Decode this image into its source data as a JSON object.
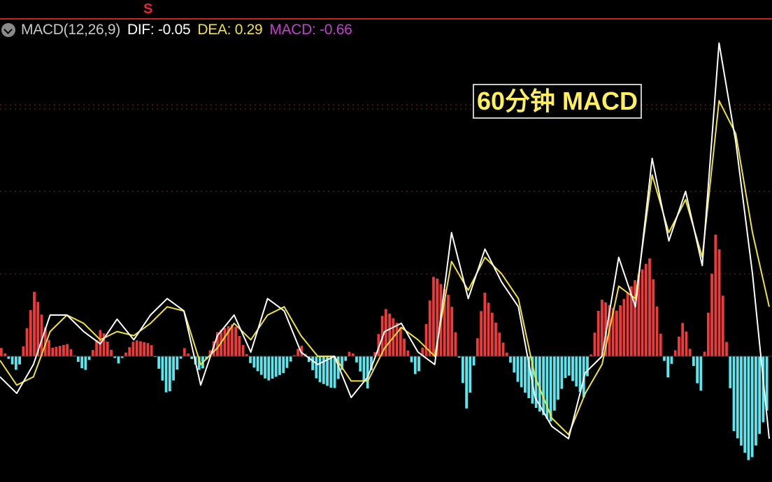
{
  "indicator": {
    "name": "MACD(12,26,9)",
    "dif_text": "DIF: -0.05",
    "dea_text": "DEA: 0.29",
    "macd_text": "MACD: -0.66"
  },
  "title_box": "60分钟 MACD",
  "top_marker": "S",
  "colors": {
    "background": "#000000",
    "dif": "#ffffff",
    "dea": "#f1e331",
    "macd_label": "#c43fd0",
    "positive_bar": "#f03a3a",
    "negative_bar": "#5ae8f0",
    "legend_name": "#c8c8c8",
    "grid": "#8a1e1e",
    "top_border": "#c42424"
  },
  "chart_data": {
    "type": "line",
    "title": "60分钟 MACD",
    "grid": true,
    "ylim": [
      -1.6,
      4.3
    ],
    "series": [
      {
        "name": "DIF",
        "values": [
          -0.25,
          -0.45,
          -0.1,
          0.5,
          0.5,
          0.3,
          0.15,
          0.45,
          0.2,
          0.5,
          0.7,
          0.55,
          -0.35,
          0.25,
          0.5,
          0.05,
          0.7,
          0.55,
          0.05,
          -0.1,
          0.0,
          -0.5,
          -0.25,
          0.3,
          0.4,
          0.05,
          -0.1,
          1.5,
          0.7,
          1.3,
          0.9,
          0.6,
          -0.5,
          -0.85,
          -1.0,
          -0.2,
          0.0,
          1.2,
          0.6,
          2.4,
          1.4,
          2.0,
          1.1,
          3.8,
          2.6,
          1.0,
          -1.0
        ]
      },
      {
        "name": "DEA",
        "values": [
          -0.05,
          -0.35,
          -0.25,
          0.3,
          0.5,
          0.4,
          0.2,
          0.3,
          0.25,
          0.4,
          0.6,
          0.55,
          -0.1,
          0.1,
          0.4,
          0.2,
          0.5,
          0.6,
          0.25,
          0.0,
          0.0,
          -0.3,
          -0.3,
          0.1,
          0.35,
          0.2,
          0.0,
          1.15,
          0.8,
          1.2,
          1.0,
          0.7,
          -0.25,
          -0.75,
          -0.95,
          -0.45,
          -0.1,
          0.85,
          0.7,
          2.2,
          1.5,
          1.9,
          1.2,
          3.1,
          2.7,
          1.5,
          0.6
        ]
      },
      {
        "name": "MACD",
        "values": [
          0.1,
          -0.2,
          0.8,
          0.1,
          0.15,
          -0.2,
          0.35,
          -0.1,
          0.2,
          0.15,
          -0.5,
          0.1,
          -0.2,
          0.3,
          0.4,
          -0.1,
          -0.3,
          -0.2,
          0.15,
          -0.3,
          -0.4,
          0.1,
          -0.4,
          0.6,
          0.35,
          -0.3,
          1.0,
          0.7,
          -0.7,
          0.8,
          0.25,
          -0.3,
          -0.6,
          -0.8,
          -0.2,
          -0.5,
          0.7,
          0.55,
          0.9,
          1.2,
          -0.3,
          0.45,
          -0.5,
          1.65,
          -0.9,
          -1.3,
          -0.66
        ]
      }
    ]
  }
}
